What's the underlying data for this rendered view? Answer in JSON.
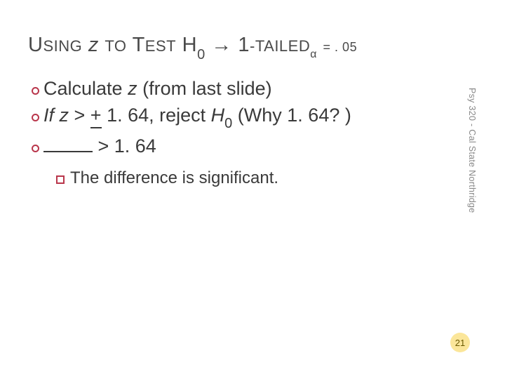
{
  "title": {
    "w1_big": "U",
    "w1_rest": "SING",
    "space1": " ",
    "w2_it": "z",
    "space2": " ",
    "w3_big": "TO",
    "space3": " ",
    "w4_big": "T",
    "w4_rest": "EST",
    "space4": " ",
    "H": "H",
    "zero": "0",
    "arrow": " → ",
    "one_big": "1",
    "dash": "-",
    "tailed_big": "T",
    "tailed_rest": "AILED",
    "alpha": "α",
    "eq": " = . 05"
  },
  "bullets": {
    "b1_a": "Calculate ",
    "b1_z": "z",
    "b1_b": " (from last slide)",
    "b2_a": "If  ",
    "b2_z": "z",
    "b2_gt": " > ",
    "b2_plus": "+",
    "b2_num": " 1. 64, reject ",
    "b2_H": "H",
    "b2_zero": "0",
    "b2_why": " (Why 1. 64? )",
    "b3_gt": " > 1. 64",
    "sub_a": "The difference is significant."
  },
  "side_text": "Psy 320 - Cal State Northridge",
  "page_number": "21"
}
